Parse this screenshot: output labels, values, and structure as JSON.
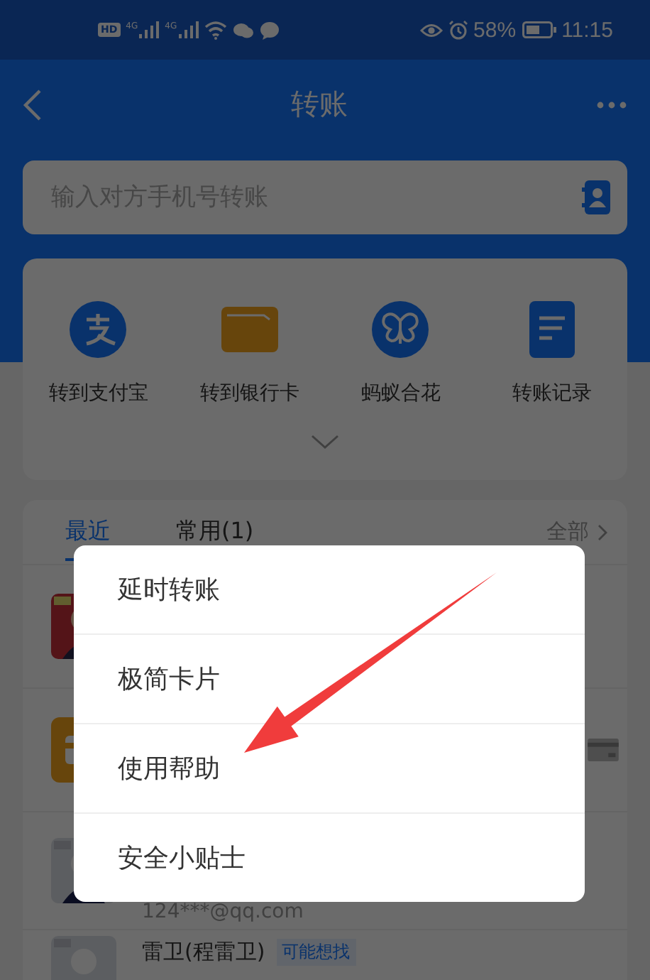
{
  "status_bar": {
    "hd": "HD",
    "networks": [
      "4G",
      "4G"
    ],
    "battery": "58%",
    "time": "11:15"
  },
  "header": {
    "title": "转账"
  },
  "search": {
    "placeholder": "输入对方手机号转账"
  },
  "shortcuts": [
    {
      "label": "转到支付宝",
      "kind": "alipay"
    },
    {
      "label": "转到银行卡",
      "kind": "card"
    },
    {
      "label": "蚂蚁合花",
      "kind": "flower"
    },
    {
      "label": "转账记录",
      "kind": "records"
    }
  ],
  "contacts": {
    "tabs": [
      {
        "label": "最近",
        "selected": true
      },
      {
        "label": "常用(1)",
        "selected": false
      }
    ],
    "all_link": "全部",
    "rows": [
      {
        "kind": "picture"
      },
      {
        "kind": "bank"
      },
      {
        "kind": "picture",
        "account": "124***@qq.com"
      },
      {
        "kind": "picture",
        "name": "雷卫(程雷卫)",
        "tag": "可能想找"
      }
    ]
  },
  "menu": {
    "items": [
      "延时转账",
      "极简卡片",
      "使用帮助",
      "安全小贴士"
    ]
  }
}
